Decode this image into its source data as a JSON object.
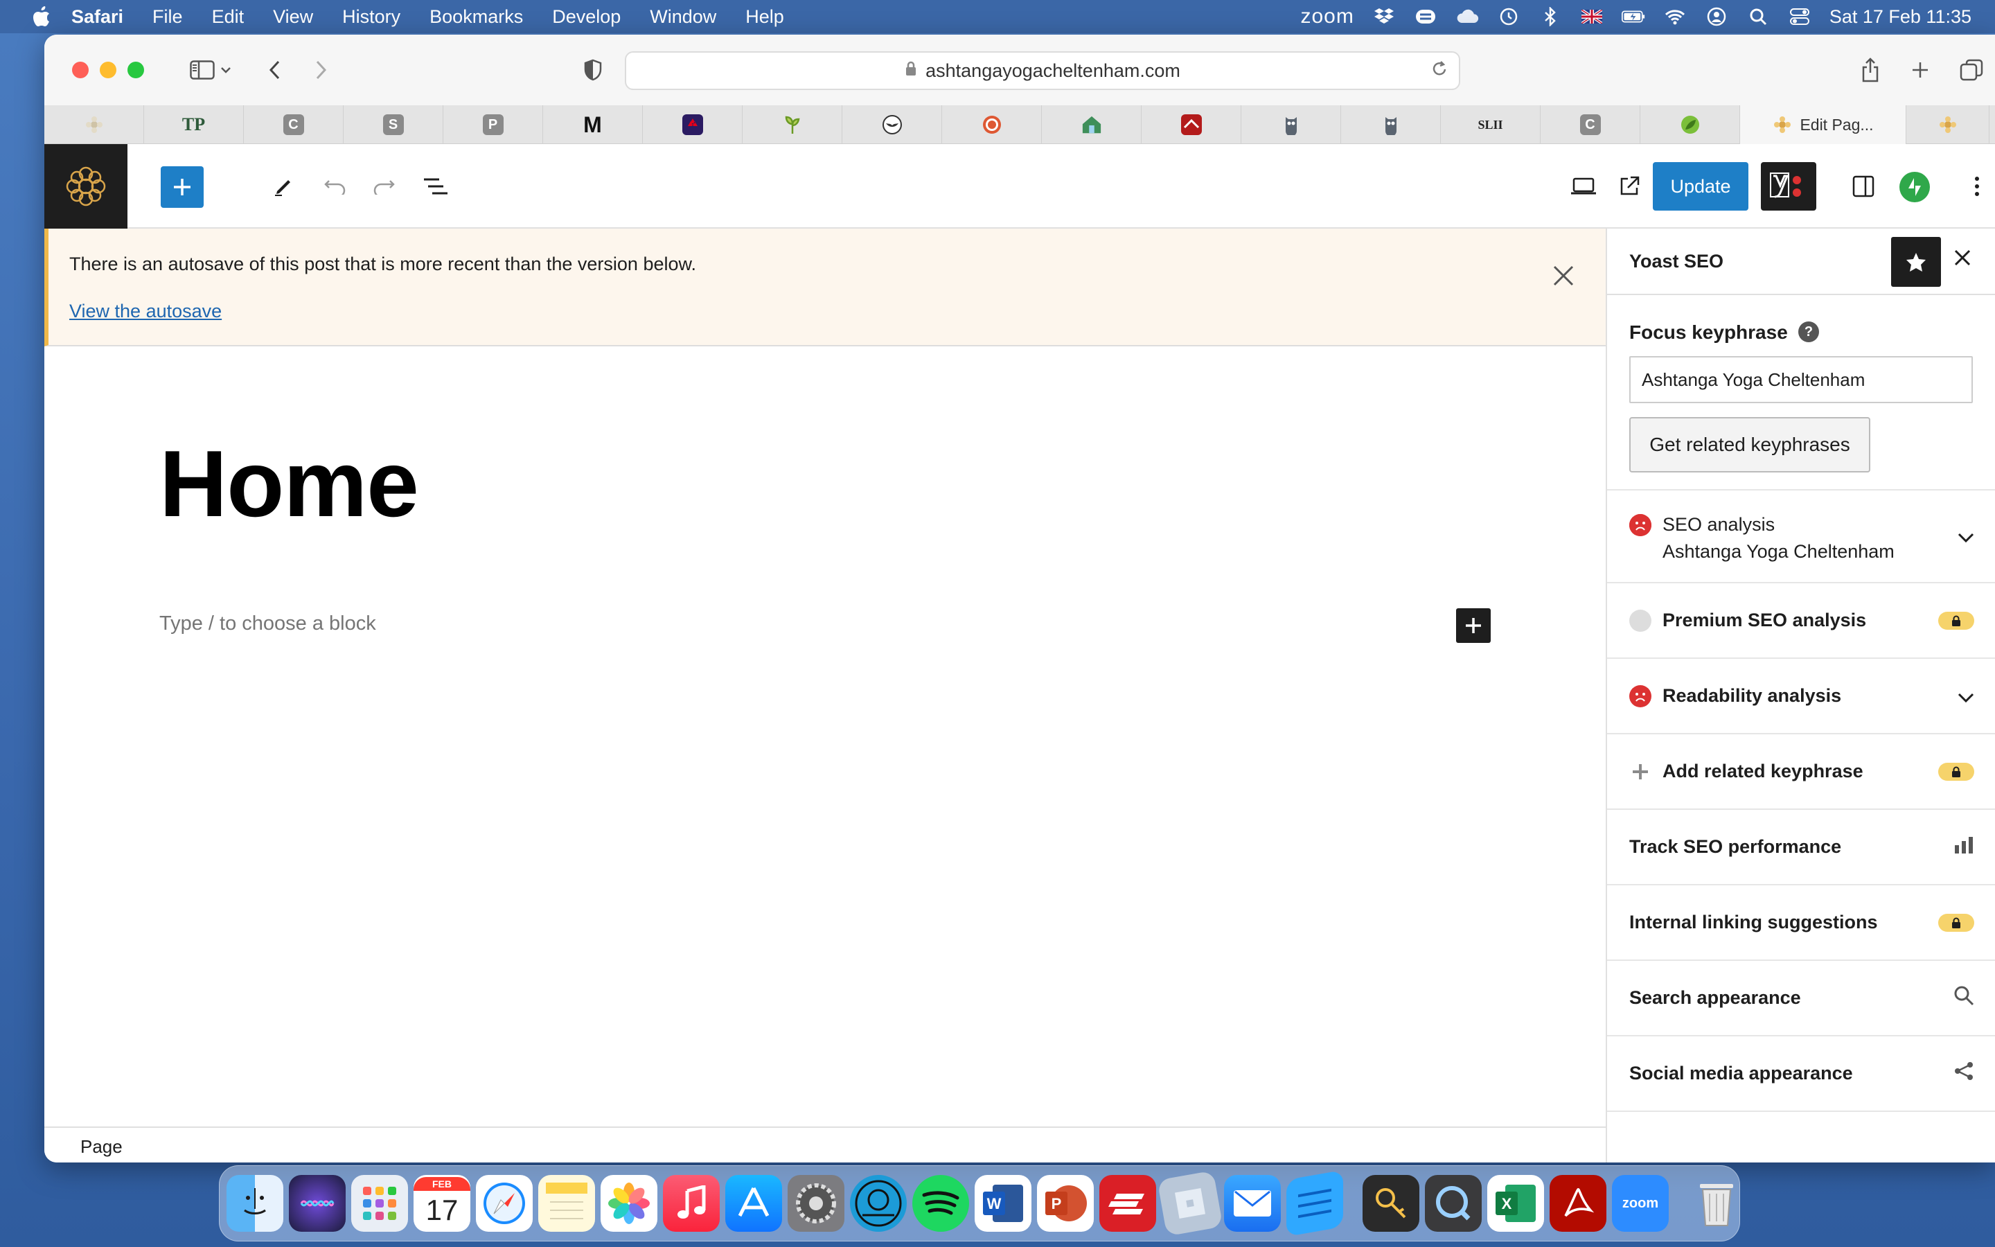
{
  "menubar": {
    "app": "Safari",
    "items": [
      "File",
      "Edit",
      "View",
      "History",
      "Bookmarks",
      "Develop",
      "Window",
      "Help"
    ],
    "zoom": "zoom",
    "datetime": "Sat 17 Feb  11:35"
  },
  "browser": {
    "url": "ashtangayogacheltenham.com",
    "tabs": [
      {
        "label": "",
        "icon": "flower-icon",
        "color": "#cfc3a7"
      },
      {
        "label": "TP",
        "icon": "tp-icon",
        "color": "#2e5a3a"
      },
      {
        "label": "C",
        "icon": "c-icon",
        "color": "#8a8a8a"
      },
      {
        "label": "S",
        "icon": "s-icon",
        "color": "#8a8a8a"
      },
      {
        "label": "P",
        "icon": "p-icon",
        "color": "#8a8a8a"
      },
      {
        "label": "M",
        "icon": "medium-icon",
        "color": "#111111"
      },
      {
        "label": "",
        "icon": "natwest-icon",
        "color": "#2b1b62"
      },
      {
        "label": "",
        "icon": "sprout-icon",
        "color": "#e9efc2"
      },
      {
        "label": "",
        "icon": "bird-icon",
        "color": "#ffffff"
      },
      {
        "label": "",
        "icon": "duckduckgo-icon",
        "color": "#de5833"
      },
      {
        "label": "",
        "icon": "house-icon",
        "color": "#3f8f5a"
      },
      {
        "label": "",
        "icon": "roof-icon",
        "color": "#b31b1b"
      },
      {
        "label": "",
        "icon": "owl-icon",
        "color": "#5a6470"
      },
      {
        "label": "",
        "icon": "owl-icon",
        "color": "#5a6470"
      },
      {
        "label": "SLII",
        "icon": "slii-icon",
        "color": "#222222"
      },
      {
        "label": "C",
        "icon": "c-icon",
        "color": "#8a8a8a"
      },
      {
        "label": "",
        "icon": "leaf-icon",
        "color": "#7bbf3a"
      }
    ],
    "active_tab": "Edit Pag..."
  },
  "editor": {
    "update_label": "Update",
    "notice": {
      "message": "There is an autosave of this post that is more recent than the version below.",
      "link": "View the autosave"
    },
    "post_title": "Home",
    "block_placeholder": "Type / to choose a block",
    "footer_breadcrumb": "Page"
  },
  "yoast": {
    "title": "Yoast SEO",
    "focus_label": "Focus keyphrase",
    "focus_value": "Ashtanga Yoga Cheltenham",
    "related_button": "Get related keyphrases",
    "rows": [
      {
        "label": "SEO analysis",
        "sub": "Ashtanga Yoga Cheltenham"
      },
      {
        "label": "Premium SEO analysis"
      },
      {
        "label": "Readability analysis"
      },
      {
        "label": "Add related keyphrase"
      },
      {
        "label": "Track SEO performance"
      },
      {
        "label": "Internal linking suggestions"
      },
      {
        "label": "Search appearance"
      },
      {
        "label": "Social media appearance"
      }
    ]
  },
  "dock": {
    "calendar_month": "FEB",
    "calendar_day": "17",
    "zoom_label": "zoom"
  },
  "colors": {
    "wp_blue": "#1e7fc7",
    "notice_bg": "#fdf6ed",
    "notice_border": "#f0b849",
    "error_red": "#dc3232",
    "premium_badge": "#f6d36b"
  }
}
